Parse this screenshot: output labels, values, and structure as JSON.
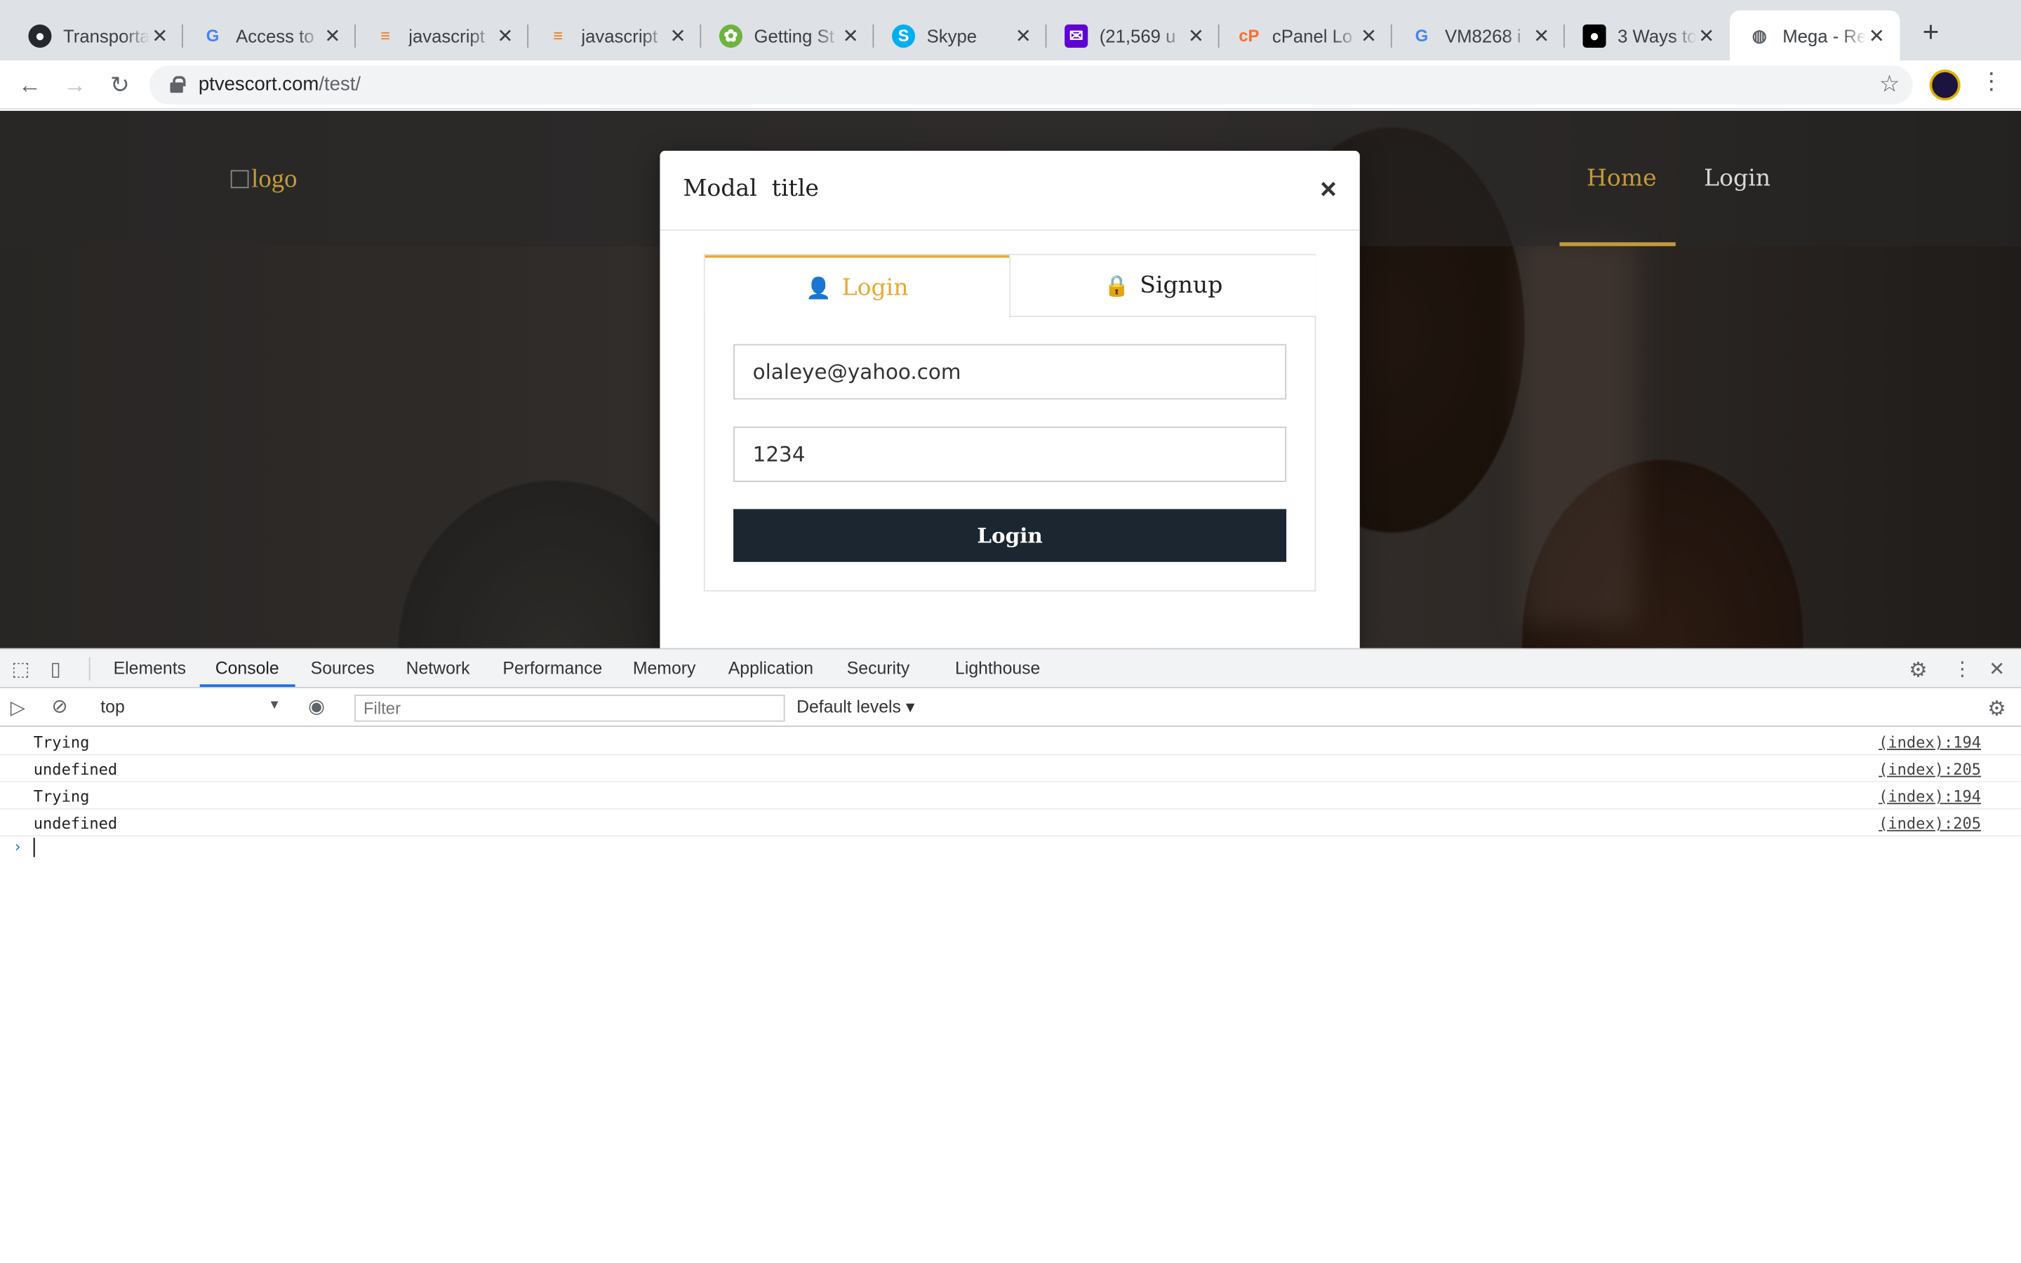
{
  "browser": {
    "tabs": [
      {
        "title": "Transporta",
        "icon": "github-icon"
      },
      {
        "title": "Access to",
        "icon": "google-icon"
      },
      {
        "title": "javascript",
        "icon": "stackoverflow-icon"
      },
      {
        "title": "javascript",
        "icon": "stackoverflow-icon"
      },
      {
        "title": "Getting St",
        "icon": "spring-icon"
      },
      {
        "title": "Skype",
        "icon": "skype-icon"
      },
      {
        "title": "(21,569 u",
        "icon": "mail-icon"
      },
      {
        "title": "cPanel Lo",
        "icon": "cpanel-icon"
      },
      {
        "title": "VM8268 i",
        "icon": "google-icon"
      },
      {
        "title": "3 Ways to",
        "icon": "medium-icon"
      },
      {
        "title": "Mega - Re",
        "icon": "globe-icon"
      }
    ],
    "url_host": "ptvescort.com",
    "url_path": "/test/"
  },
  "site": {
    "logo_alt": "logo",
    "nav_home": "Home",
    "nav_login": "Login"
  },
  "modal": {
    "title": "Modal  title",
    "close": "×",
    "tab_login": "Login",
    "tab_signup": "Signup",
    "email_value": "olaleye@yahoo.com",
    "password_value": "1234",
    "submit_label": "Login"
  },
  "devtools": {
    "tabs": [
      "Elements",
      "Console",
      "Sources",
      "Network",
      "Performance",
      "Memory",
      "Application",
      "Security",
      "Lighthouse"
    ],
    "active_tab": "Console",
    "context": "top",
    "filter_placeholder": "Filter",
    "levels": "Default levels ▾",
    "console": [
      {
        "msg": "Trying",
        "src": "(index):194"
      },
      {
        "msg": "undefined",
        "src": "(index):205"
      },
      {
        "msg": "Trying",
        "src": "(index):194"
      },
      {
        "msg": "undefined",
        "src": "(index):205"
      }
    ],
    "prompt": "›"
  },
  "colors": {
    "accent": "#e8a933",
    "button_dark": "#1b2630",
    "devtools_active": "#1a73e8"
  }
}
